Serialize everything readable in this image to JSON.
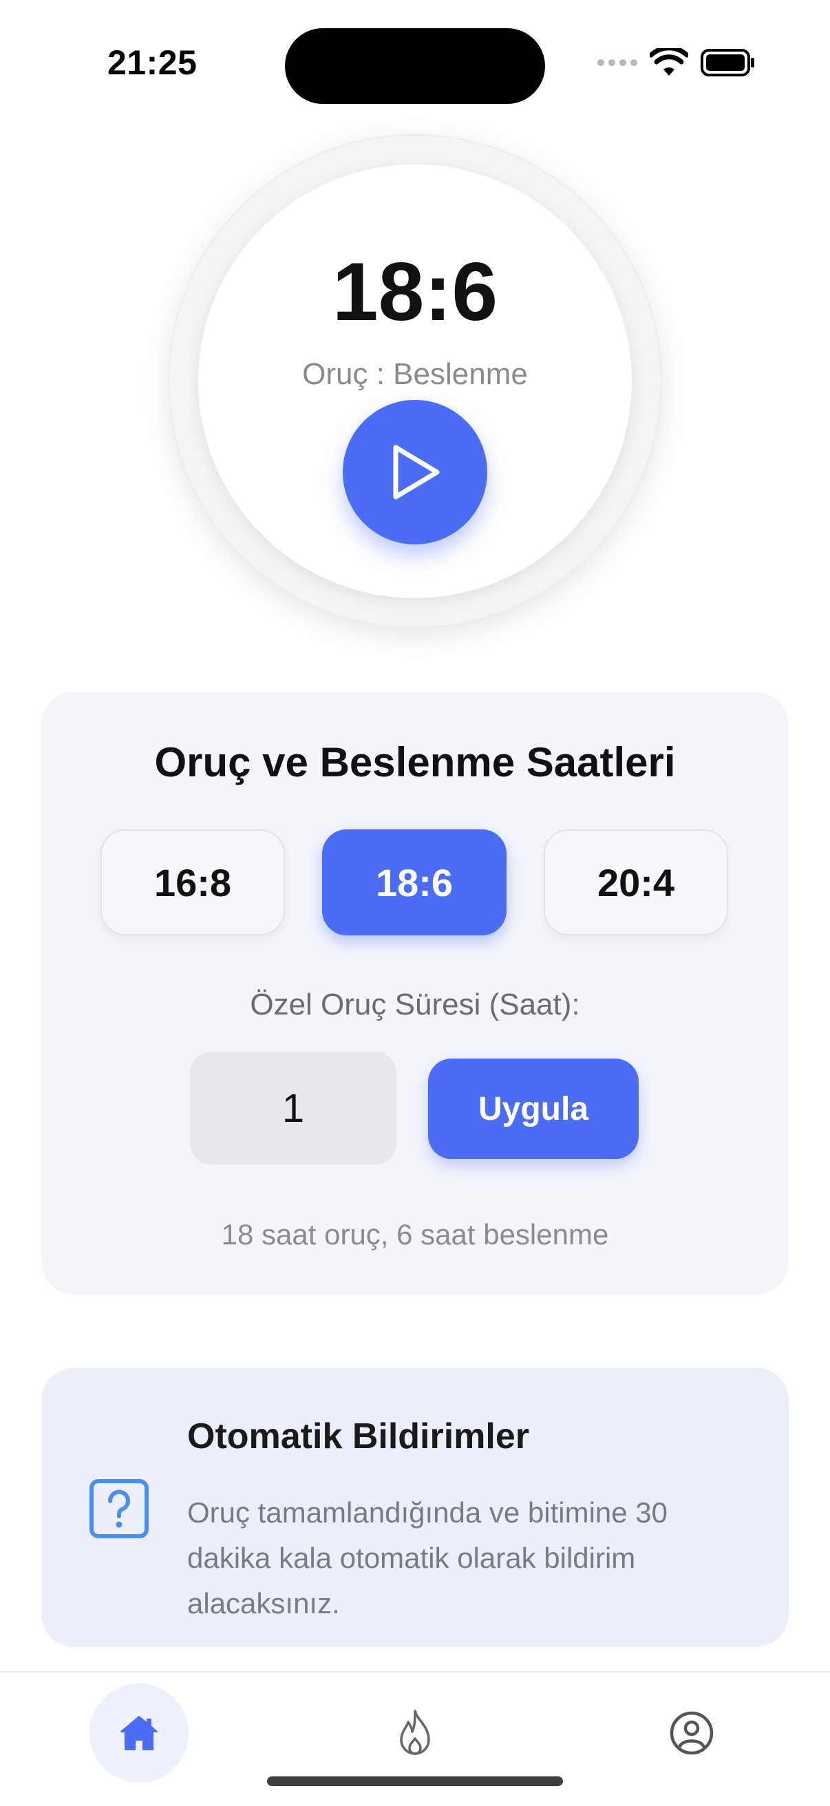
{
  "status_bar": {
    "time": "21:25"
  },
  "timer": {
    "ratio": "18:6",
    "label": "Oruç : Beslenme",
    "play_icon": "play-icon"
  },
  "hours_card": {
    "title": "Oruç ve Beslenme Saatleri",
    "presets": [
      {
        "label": "16:8",
        "selected": false
      },
      {
        "label": "18:6",
        "selected": true
      },
      {
        "label": "20:4",
        "selected": false
      }
    ],
    "custom_label": "Özel Oruç Süresi (Saat):",
    "custom_value": "1",
    "apply_label": "Uygula",
    "summary": "18 saat oruç, 6 saat beslenme"
  },
  "notification_card": {
    "icon": "question-icon",
    "title": "Otomatik Bildirimler",
    "text": "Oruç tamamlandığında ve bitimine 30 dakika kala otomatik olarak bildirim alacaksınız."
  },
  "tab_bar": {
    "tabs": [
      {
        "icon": "home-icon",
        "active": true
      },
      {
        "icon": "flame-icon",
        "active": false
      },
      {
        "icon": "profile-icon",
        "active": false
      }
    ]
  },
  "colors": {
    "accent": "#4a6cf7",
    "card_background": "#f4f5fb",
    "notification_background": "#eceefb",
    "question_icon": "#4a8ef0"
  }
}
